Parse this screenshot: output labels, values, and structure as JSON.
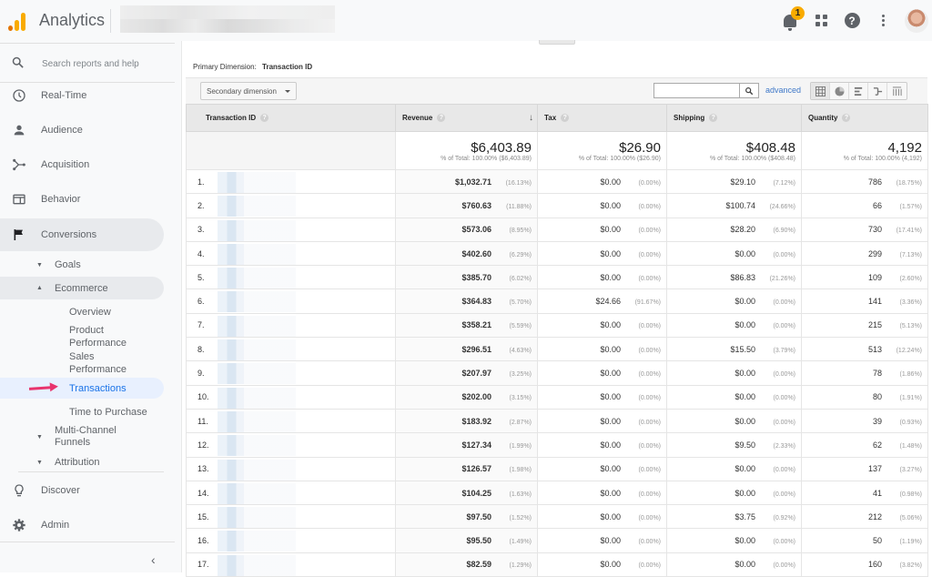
{
  "header": {
    "app_title": "Analytics",
    "notification_count": "1",
    "icons": [
      "notifications-bell-icon",
      "apps-grid-icon",
      "help-icon",
      "more-vert-icon",
      "account-avatar"
    ]
  },
  "sidebar": {
    "search_placeholder": "Search reports and help",
    "nav": [
      {
        "label": "Real-Time",
        "icon": "clock-icon"
      },
      {
        "label": "Audience",
        "icon": "person-icon"
      },
      {
        "label": "Acquisition",
        "icon": "acquisition-icon"
      },
      {
        "label": "Behavior",
        "icon": "behavior-icon"
      },
      {
        "label": "Conversions",
        "icon": "flag-icon"
      }
    ],
    "conversions_sub": [
      {
        "label": "Goals",
        "expanded": false
      },
      {
        "label": "Ecommerce",
        "expanded": true
      },
      {
        "label": "Multi-Channel Funnels",
        "expanded": false
      },
      {
        "label": "Attribution",
        "expanded": false
      }
    ],
    "ecommerce_items": [
      {
        "label": "Overview"
      },
      {
        "label": "Product Performance"
      },
      {
        "label": "Sales Performance"
      },
      {
        "label": "Transactions",
        "active": true
      },
      {
        "label": "Time to Purchase"
      }
    ],
    "bottom": [
      {
        "label": "Discover",
        "icon": "lightbulb-icon"
      },
      {
        "label": "Admin",
        "icon": "gear-icon"
      }
    ],
    "collapse_glyph": "‹"
  },
  "report": {
    "primary_dimension_label": "Primary Dimension:",
    "primary_dimension_value": "Transaction ID",
    "secondary_dimension": "Secondary dimension",
    "search_value": "",
    "advanced_label": "advanced",
    "view_modes": [
      "table-view",
      "pie-view",
      "performance-view",
      "comparison-view",
      "pivot-view"
    ],
    "active_view": "table-view",
    "columns": [
      "Transaction ID",
      "Revenue",
      "Tax",
      "Shipping",
      "Quantity"
    ],
    "sorted_by": "Revenue",
    "totals": {
      "revenue": "$6,403.89",
      "revenue_sub": "% of Total: 100.00% ($6,403.89)",
      "tax": "$26.90",
      "tax_sub": "% of Total: 100.00% ($26.90)",
      "shipping": "$408.48",
      "shipping_sub": "% of Total: 100.00% ($408.48)",
      "quantity": "4,192",
      "quantity_sub": "% of Total: 100.00% (4,192)"
    },
    "rows": [
      {
        "idx": "1.",
        "revenue": "$1,032.71",
        "revenue_pct": "(16.13%)",
        "tax": "$0.00",
        "tax_pct": "(0.00%)",
        "shipping": "$29.10",
        "shipping_pct": "(7.12%)",
        "quantity": "786",
        "quantity_pct": "(18.75%)"
      },
      {
        "idx": "2.",
        "revenue": "$760.63",
        "revenue_pct": "(11.88%)",
        "tax": "$0.00",
        "tax_pct": "(0.00%)",
        "shipping": "$100.74",
        "shipping_pct": "(24.66%)",
        "quantity": "66",
        "quantity_pct": "(1.57%)"
      },
      {
        "idx": "3.",
        "revenue": "$573.06",
        "revenue_pct": "(8.95%)",
        "tax": "$0.00",
        "tax_pct": "(0.00%)",
        "shipping": "$28.20",
        "shipping_pct": "(6.90%)",
        "quantity": "730",
        "quantity_pct": "(17.41%)"
      },
      {
        "idx": "4.",
        "revenue": "$402.60",
        "revenue_pct": "(6.29%)",
        "tax": "$0.00",
        "tax_pct": "(0.00%)",
        "shipping": "$0.00",
        "shipping_pct": "(0.00%)",
        "quantity": "299",
        "quantity_pct": "(7.13%)"
      },
      {
        "idx": "5.",
        "revenue": "$385.70",
        "revenue_pct": "(6.02%)",
        "tax": "$0.00",
        "tax_pct": "(0.00%)",
        "shipping": "$86.83",
        "shipping_pct": "(21.26%)",
        "quantity": "109",
        "quantity_pct": "(2.60%)"
      },
      {
        "idx": "6.",
        "revenue": "$364.83",
        "revenue_pct": "(5.70%)",
        "tax": "$24.66",
        "tax_pct": "(91.67%)",
        "shipping": "$0.00",
        "shipping_pct": "(0.00%)",
        "quantity": "141",
        "quantity_pct": "(3.36%)"
      },
      {
        "idx": "7.",
        "revenue": "$358.21",
        "revenue_pct": "(5.59%)",
        "tax": "$0.00",
        "tax_pct": "(0.00%)",
        "shipping": "$0.00",
        "shipping_pct": "(0.00%)",
        "quantity": "215",
        "quantity_pct": "(5.13%)"
      },
      {
        "idx": "8.",
        "revenue": "$296.51",
        "revenue_pct": "(4.63%)",
        "tax": "$0.00",
        "tax_pct": "(0.00%)",
        "shipping": "$15.50",
        "shipping_pct": "(3.79%)",
        "quantity": "513",
        "quantity_pct": "(12.24%)"
      },
      {
        "idx": "9.",
        "revenue": "$207.97",
        "revenue_pct": "(3.25%)",
        "tax": "$0.00",
        "tax_pct": "(0.00%)",
        "shipping": "$0.00",
        "shipping_pct": "(0.00%)",
        "quantity": "78",
        "quantity_pct": "(1.86%)"
      },
      {
        "idx": "10.",
        "revenue": "$202.00",
        "revenue_pct": "(3.15%)",
        "tax": "$0.00",
        "tax_pct": "(0.00%)",
        "shipping": "$0.00",
        "shipping_pct": "(0.00%)",
        "quantity": "80",
        "quantity_pct": "(1.91%)"
      },
      {
        "idx": "11.",
        "revenue": "$183.92",
        "revenue_pct": "(2.87%)",
        "tax": "$0.00",
        "tax_pct": "(0.00%)",
        "shipping": "$0.00",
        "shipping_pct": "(0.00%)",
        "quantity": "39",
        "quantity_pct": "(0.93%)"
      },
      {
        "idx": "12.",
        "revenue": "$127.34",
        "revenue_pct": "(1.99%)",
        "tax": "$0.00",
        "tax_pct": "(0.00%)",
        "shipping": "$9.50",
        "shipping_pct": "(2.33%)",
        "quantity": "62",
        "quantity_pct": "(1.48%)"
      },
      {
        "idx": "13.",
        "revenue": "$126.57",
        "revenue_pct": "(1.98%)",
        "tax": "$0.00",
        "tax_pct": "(0.00%)",
        "shipping": "$0.00",
        "shipping_pct": "(0.00%)",
        "quantity": "137",
        "quantity_pct": "(3.27%)"
      },
      {
        "idx": "14.",
        "revenue": "$104.25",
        "revenue_pct": "(1.63%)",
        "tax": "$0.00",
        "tax_pct": "(0.00%)",
        "shipping": "$0.00",
        "shipping_pct": "(0.00%)",
        "quantity": "41",
        "quantity_pct": "(0.98%)"
      },
      {
        "idx": "15.",
        "revenue": "$97.50",
        "revenue_pct": "(1.52%)",
        "tax": "$0.00",
        "tax_pct": "(0.00%)",
        "shipping": "$3.75",
        "shipping_pct": "(0.92%)",
        "quantity": "212",
        "quantity_pct": "(5.06%)"
      },
      {
        "idx": "16.",
        "revenue": "$95.50",
        "revenue_pct": "(1.49%)",
        "tax": "$0.00",
        "tax_pct": "(0.00%)",
        "shipping": "$0.00",
        "shipping_pct": "(0.00%)",
        "quantity": "50",
        "quantity_pct": "(1.19%)"
      },
      {
        "idx": "17.",
        "revenue": "$82.59",
        "revenue_pct": "(1.29%)",
        "tax": "$0.00",
        "tax_pct": "(0.00%)",
        "shipping": "$0.00",
        "shipping_pct": "(0.00%)",
        "quantity": "160",
        "quantity_pct": "(3.82%)"
      }
    ]
  },
  "colors": {
    "accent_blue": "#1a73e8",
    "logo_orange": "#f9ab00",
    "logo_dark_orange": "#e37400",
    "annotation_arrow": "#e8336d",
    "link_blue": "#3f78c8"
  }
}
